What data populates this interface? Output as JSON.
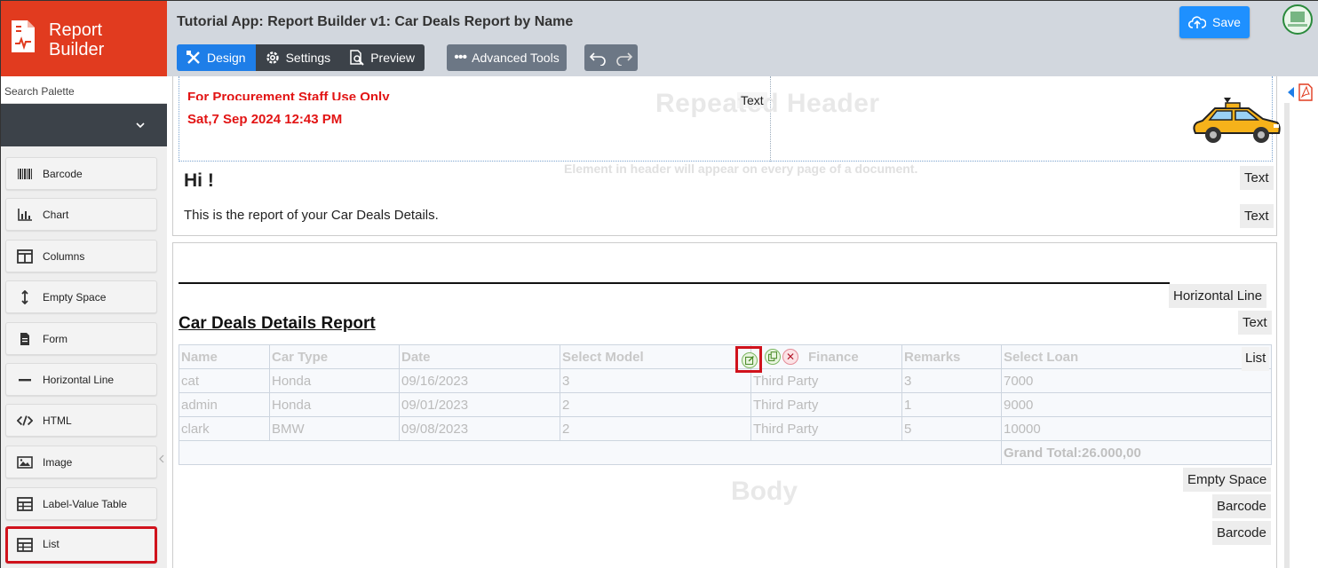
{
  "brand": {
    "line1": "Report",
    "line2": "Builder"
  },
  "search": {
    "placeholder": "Search Palette"
  },
  "palette": [
    {
      "label": "Barcode",
      "icon": "barcode-icon"
    },
    {
      "label": "Chart",
      "icon": "chart-icon"
    },
    {
      "label": "Columns",
      "icon": "columns-icon"
    },
    {
      "label": "Empty Space",
      "icon": "vertical-arrows-icon"
    },
    {
      "label": "Form",
      "icon": "form-icon"
    },
    {
      "label": "Horizontal Line",
      "icon": "minus-icon"
    },
    {
      "label": "HTML",
      "icon": "code-icon"
    },
    {
      "label": "Image",
      "icon": "image-icon"
    },
    {
      "label": "Label-Value Table",
      "icon": "table-icon"
    },
    {
      "label": "List",
      "icon": "list-table-icon"
    }
  ],
  "topbar": {
    "title": "Tutorial App: Report Builder v1: Car Deals Report by Name",
    "design": "Design",
    "settings": "Settings",
    "preview": "Preview",
    "advanced": "Advanced Tools",
    "save": "Save"
  },
  "header": {
    "red_line1": "For Procurement Staff Use Only",
    "red_line2": "Sat,7 Sep 2024 12:43 PM",
    "ghost_title": "Repeated Header",
    "text_tag": "Text",
    "ghost_note": "Element in header will appear on every page of a document.",
    "hi": "Hi !",
    "intro": "This is the report of your Car Deals Details.",
    "tag_text1": "Text",
    "tag_text2": "Text"
  },
  "body": {
    "tag_hline": "Horizontal Line",
    "tag_text": "Text",
    "tag_list": "List",
    "tag_empty": "Empty Space",
    "tag_barcode1": "Barcode",
    "tag_barcode2": "Barcode",
    "report_title": "Car Deals Details Report",
    "ghost_body": "Body",
    "table": {
      "headers": [
        "Name",
        "Car Type",
        "Date",
        "Select Model",
        "Finance",
        "Remarks",
        "Select Loan"
      ],
      "rows": [
        [
          "cat",
          "Honda",
          "09/16/2023",
          "3",
          "Third Party",
          "3",
          "7000"
        ],
        [
          "admin",
          "Honda",
          "09/01/2023",
          "2",
          "Third Party",
          "1",
          "9000"
        ],
        [
          "clark",
          "BMW",
          "09/08/2023",
          "2",
          "Third Party",
          "5",
          "10000"
        ]
      ],
      "total": "Grand Total:26.000,00"
    }
  }
}
